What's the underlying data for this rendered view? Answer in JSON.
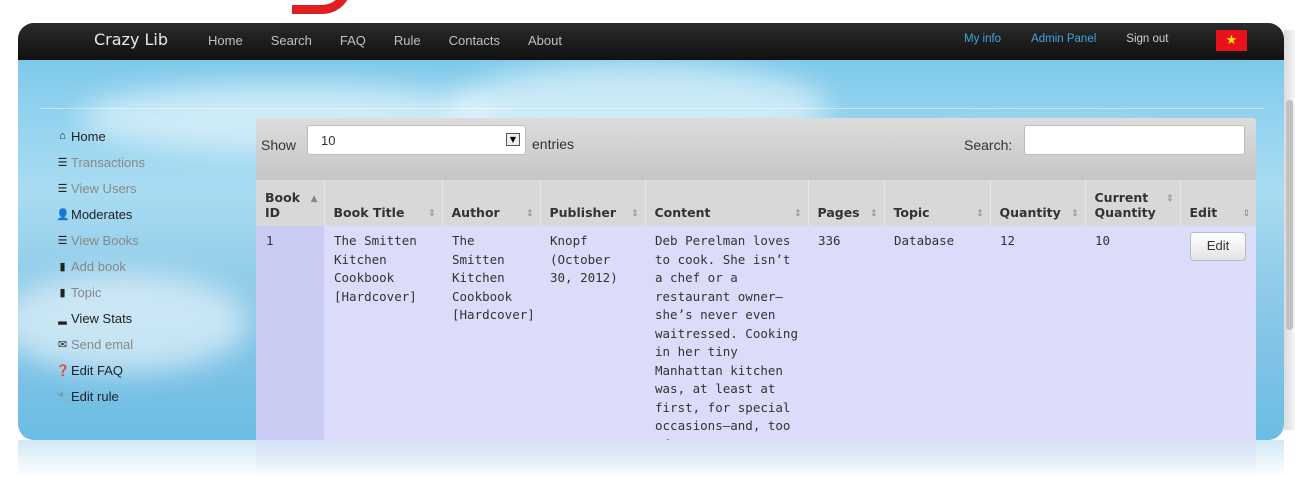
{
  "navbar": {
    "brand": "Crazy Lib",
    "links": [
      "Home",
      "Search",
      "FAQ",
      "Rule",
      "Contacts",
      "About"
    ],
    "my_info": "My info",
    "admin_panel": "Admin Panel",
    "sign_out": "Sign out",
    "flag_icon": "vietnam-flag-icon"
  },
  "sidebar": {
    "items": [
      {
        "label": "Home",
        "icon": "home-icon"
      },
      {
        "label": "Transactions",
        "icon": "list-icon"
      },
      {
        "label": "View Users",
        "icon": "list-icon"
      },
      {
        "label": "Moderates",
        "icon": "user-icon"
      },
      {
        "label": "View Books",
        "icon": "list-icon"
      },
      {
        "label": "Add book",
        "icon": "book-icon"
      },
      {
        "label": "Topic",
        "icon": "book-icon"
      },
      {
        "label": "View Stats",
        "icon": "signal-icon"
      },
      {
        "label": "Send emal",
        "icon": "envelope-icon"
      },
      {
        "label": "Edit FAQ",
        "icon": "question-icon"
      },
      {
        "label": "Edit rule",
        "icon": "wrench-icon"
      }
    ]
  },
  "table_controls": {
    "show_label": "Show",
    "entries_value": "10",
    "entries_label": "entries",
    "search_label": "Search:",
    "search_value": ""
  },
  "table": {
    "columns": [
      "Book ID",
      "Book Title",
      "Author",
      "Publisher",
      "Content",
      "Pages",
      "Topic",
      "Quantity",
      "Current Quantity",
      "Edit"
    ],
    "rows": [
      {
        "book_id": "1",
        "title": "The Smitten Kitchen Cookbook [Hardcover]",
        "author": "The Smitten Kitchen Cookbook [Hardcover]",
        "publisher": "Knopf (October 30, 2012)",
        "content": "Deb Perelman loves to cook. She isn’t a chef or a restaurant owner—she’s never even waitressed. Cooking in her tiny Manhattan kitchen was, at least at first, for special occasions—and, too often, an unnecessarily",
        "pages": "336",
        "topic": "Database",
        "quantity": "12",
        "current_quantity": "10",
        "edit_label": "Edit"
      }
    ]
  }
}
